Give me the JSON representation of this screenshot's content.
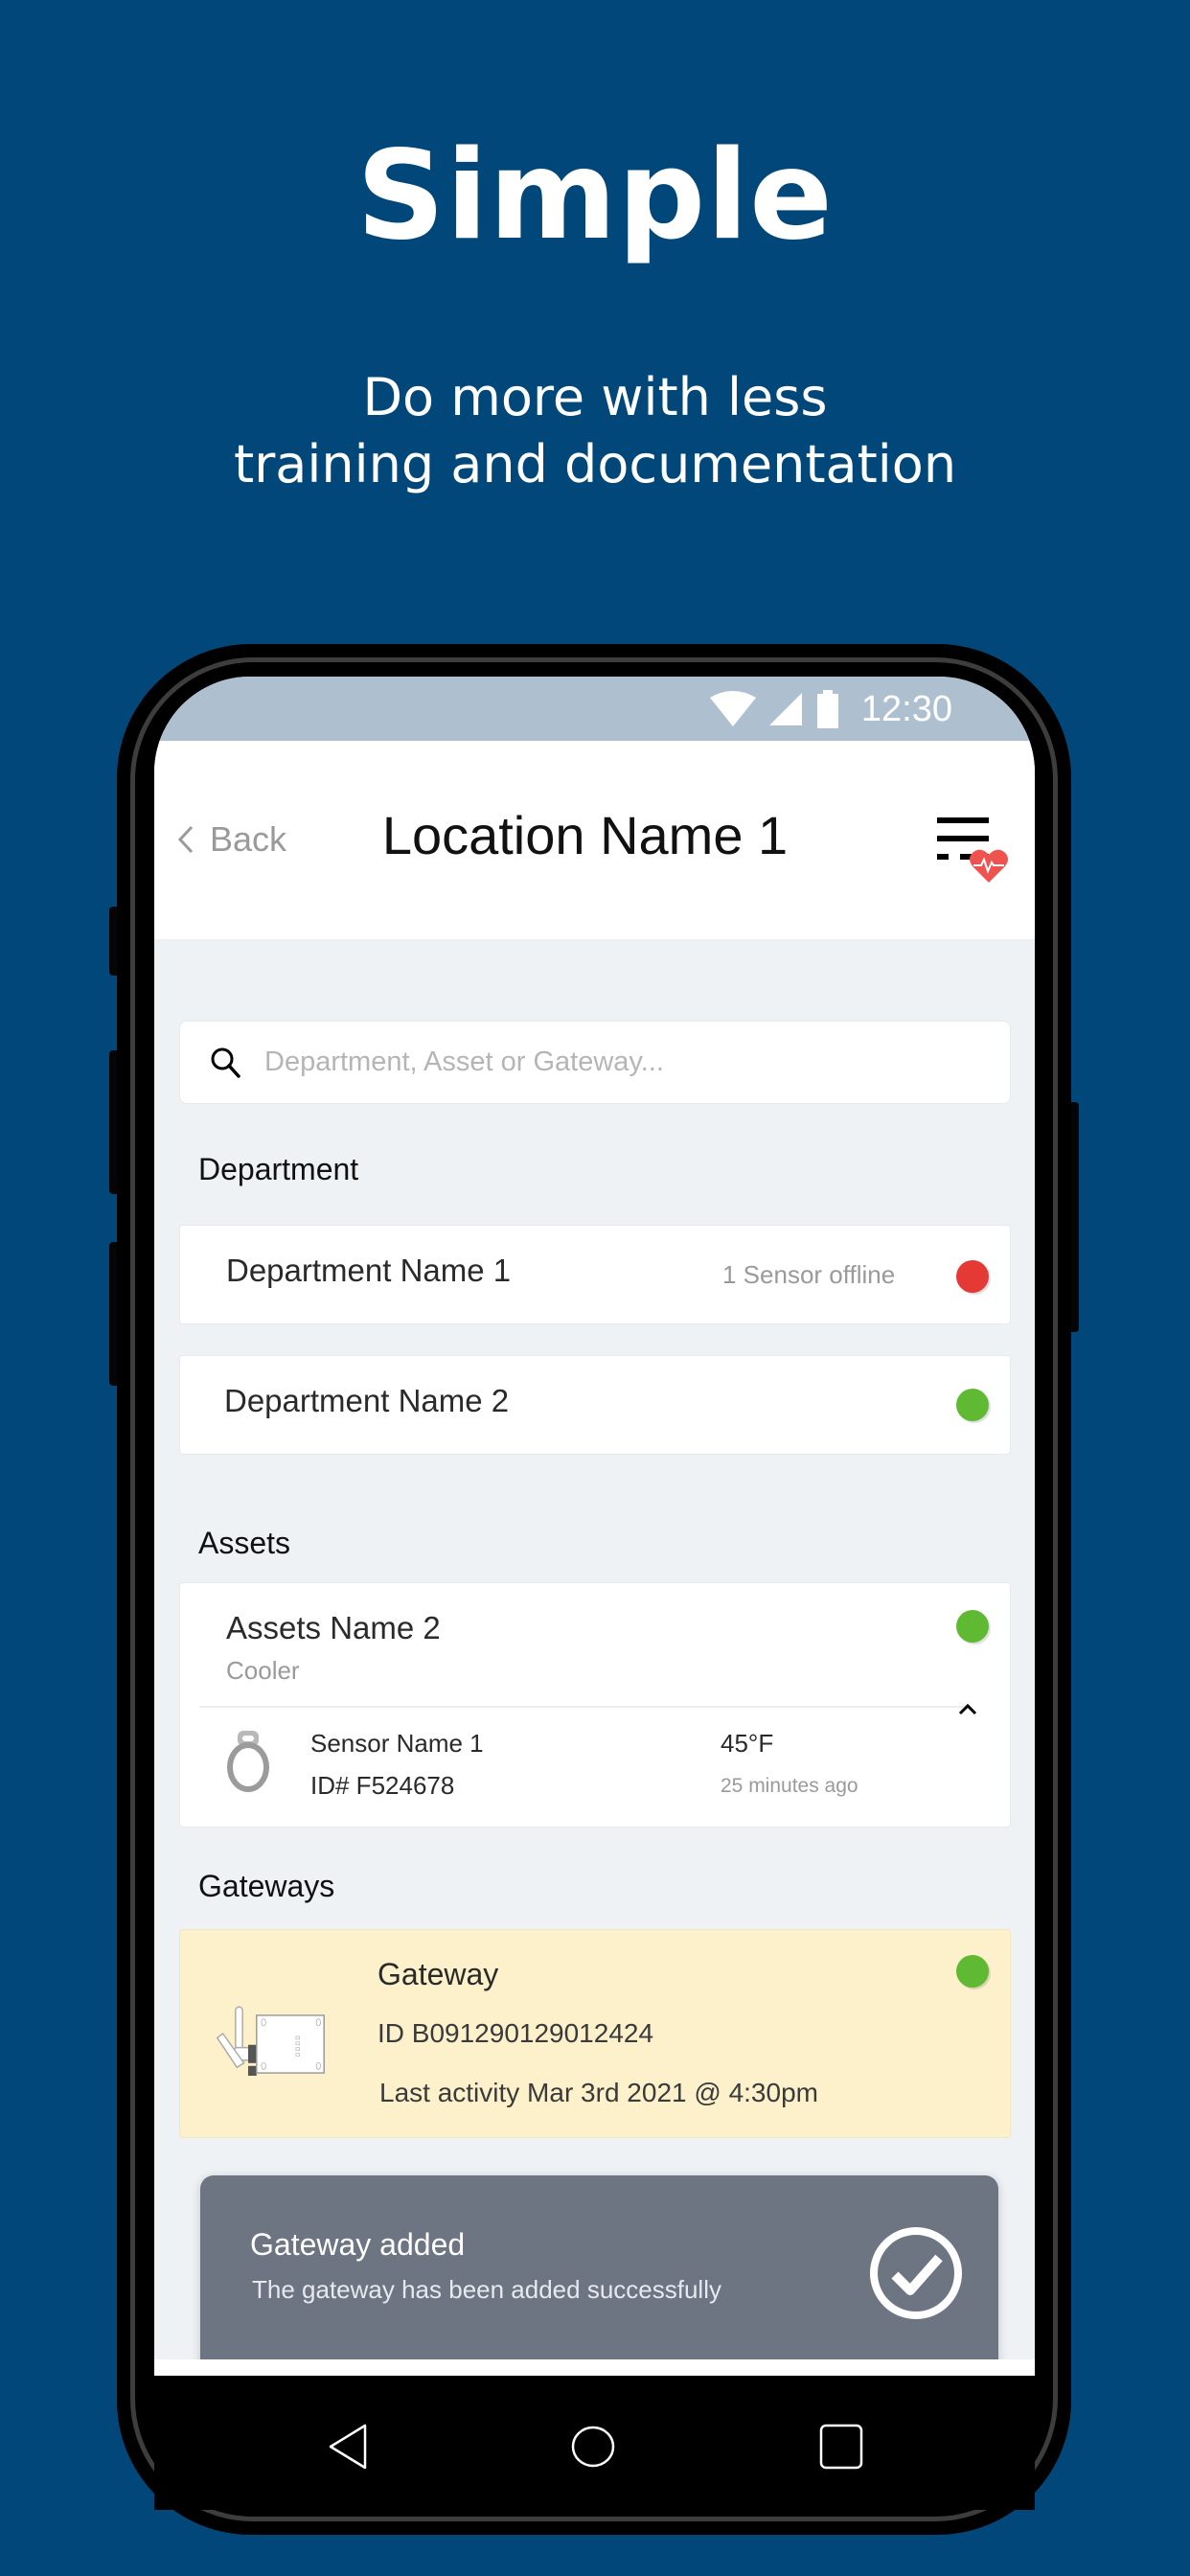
{
  "promo": {
    "headline": "Simple",
    "subline_1": "Do more with less",
    "subline_2": "training and documentation"
  },
  "statusbar": {
    "time": "12:30",
    "icons": [
      "wifi-icon",
      "cellular-signal-icon",
      "battery-icon"
    ]
  },
  "appbar": {
    "back_label": "Back",
    "title": "Location Name 1",
    "menu_icon": "list-health-icon"
  },
  "search": {
    "placeholder": "Department, Asset or Gateway...",
    "value": ""
  },
  "departments": {
    "label": "Department",
    "items": [
      {
        "name": "Department Name 1",
        "meta": "1 Sensor offline",
        "status": "offline",
        "status_color": "#e53935"
      },
      {
        "name": "Department Name 2",
        "meta": "",
        "status": "online",
        "status_color": "#5fb932"
      }
    ]
  },
  "assets": {
    "label": "Assets",
    "items": [
      {
        "name": "Assets Name 2",
        "type": "Cooler",
        "status": "online",
        "status_color": "#5fb932",
        "expanded": true,
        "sensors": [
          {
            "name": "Sensor Name 1",
            "id": "ID# F524678",
            "reading": "45°F",
            "updated": "25 minutes ago"
          }
        ]
      }
    ]
  },
  "gateways": {
    "label": "Gateways",
    "items": [
      {
        "name": "Gateway",
        "id": "ID B091290129012424",
        "last_activity": "Last activity Mar 3rd 2021 @ 4:30pm",
        "status": "online",
        "status_color": "#5fb932",
        "highlight_color": "#fdf1cc"
      }
    ]
  },
  "toast": {
    "title": "Gateway added",
    "message": "The gateway has been added successfully",
    "icon": "check-circle-icon"
  },
  "navbar": {
    "buttons": [
      "back-nav",
      "home-nav",
      "recents-nav"
    ]
  },
  "colors": {
    "background": "#01477a",
    "statusbar": "#aec0cf",
    "content_bg": "#eef2f5",
    "toast_bg": "#6d7582",
    "alert_red": "#e53935",
    "ok_green": "#5fb932",
    "health_heart": "#ef5350"
  }
}
